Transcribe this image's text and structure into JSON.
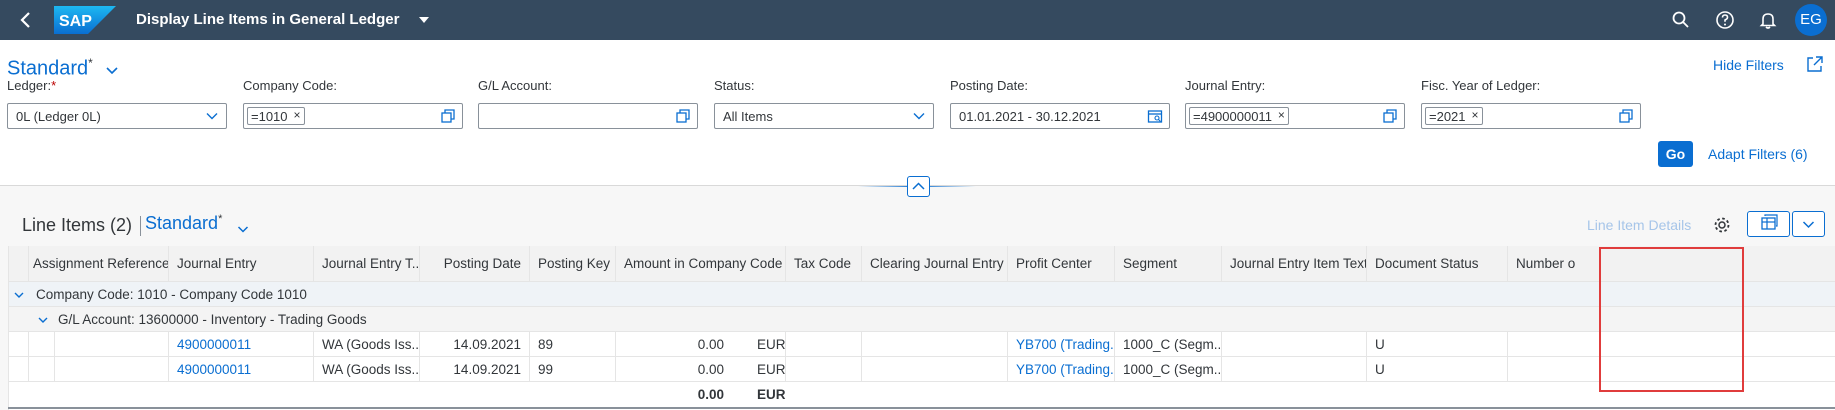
{
  "shell": {
    "title": "Display Line Items in General Ledger",
    "logo_text": "SAP",
    "avatar": "EG",
    "icons": [
      "back-icon",
      "search-icon",
      "help-icon",
      "bell-icon"
    ]
  },
  "header": {
    "variant_name": "Standard",
    "variant_modified": "*",
    "hide_filters": "Hide Filters"
  },
  "filters": [
    {
      "label": "Ledger:",
      "required": "*",
      "value": "0L (Ledger 0L)",
      "kind": "select"
    },
    {
      "label": "Company Code:",
      "token": "=1010",
      "kind": "valuehelp"
    },
    {
      "label": "G/L Account:",
      "value": "",
      "kind": "valuehelp"
    },
    {
      "label": "Status:",
      "value": "All Items",
      "kind": "select"
    },
    {
      "label": "Posting Date:",
      "value": "01.01.2021 - 30.12.2021",
      "kind": "date"
    },
    {
      "label": "Journal Entry:",
      "token": "=4900000011",
      "kind": "valuehelp"
    },
    {
      "label": "Fisc. Year of Ledger:",
      "token": "=2021",
      "kind": "valuehelp"
    }
  ],
  "go_label": "Go",
  "adapt_filters": "Adapt Filters (6)",
  "table": {
    "title": "Line Items (2)",
    "variant": "Standard",
    "variant_modified": "*",
    "line_item_details": "Line Item Details",
    "columns": [
      "Assignment Reference",
      "Journal Entry",
      "Journal Entry T...",
      "Posting Date",
      "Posting Key",
      "Amount in Company Code ...",
      "Tax Code",
      "Clearing Journal Entry",
      "Profit Center",
      "Segment",
      "Journal Entry Item Text",
      "Document Status",
      "Number o"
    ],
    "group1": "Company Code: 1010 - Company Code 1010",
    "group2": "G/L Account: 13600000 - Inventory - Trading Goods",
    "rows": [
      {
        "journal_entry": "4900000011",
        "je_type": "WA (Goods Iss...",
        "posting_date": "14.09.2021",
        "posting_key": "89",
        "amount": "0.00",
        "currency": "EUR",
        "profit_center": "YB700 (Trading...",
        "segment": "1000_C (Segm...",
        "doc_status": "U"
      },
      {
        "journal_entry": "4900000011",
        "je_type": "WA (Goods Iss...",
        "posting_date": "14.09.2021",
        "posting_key": "99",
        "amount": "0.00",
        "currency": "EUR",
        "profit_center": "YB700 (Trading...",
        "segment": "1000_C (Segm...",
        "doc_status": "U"
      }
    ],
    "total": {
      "amount": "0.00",
      "currency": "EUR"
    }
  }
}
